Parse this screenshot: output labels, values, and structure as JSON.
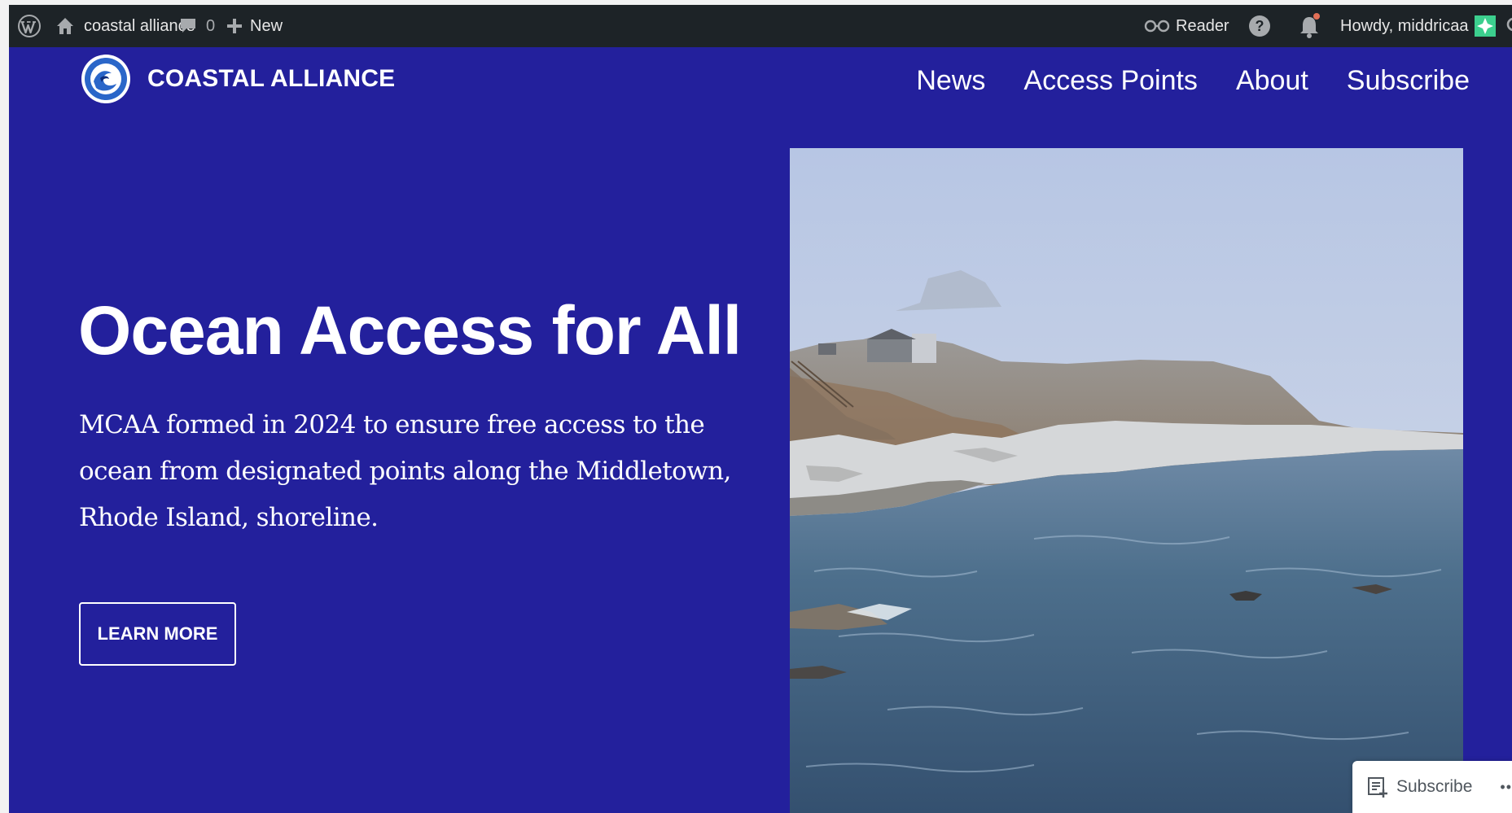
{
  "admin_bar": {
    "site_name": "coastal alliance",
    "comments_count": "0",
    "new_label": "New",
    "reader_label": "Reader",
    "greeting": "Howdy, middricaa"
  },
  "header": {
    "site_title": "COASTAL ALLIANCE",
    "nav": [
      "News",
      "Access Points",
      "About",
      "Subscribe"
    ]
  },
  "hero": {
    "title": "Ocean Access for All",
    "description": "MCAA formed in 2024 to ensure free access to the ocean from designated points along the Middletown, Rhode Island, shoreline.",
    "button_label": "LEARN MORE"
  },
  "subscribe_popup": {
    "label": "Subscribe",
    "more": "•••"
  },
  "icons": {
    "wordpress": "wordpress-icon",
    "home": "home-icon",
    "comment": "comment-icon",
    "plus": "plus-icon",
    "reader": "reader-glasses-icon",
    "help": "help-icon",
    "notifications": "bell-icon",
    "avatar": "avatar-icon",
    "search": "search-icon",
    "subscribe": "subscribe-icon",
    "more": "more-icon"
  },
  "colors": {
    "admin_bar_bg": "#1d2327",
    "site_bg": "#23209c",
    "text": "#ffffff",
    "notification_dot": "#e26f56"
  }
}
